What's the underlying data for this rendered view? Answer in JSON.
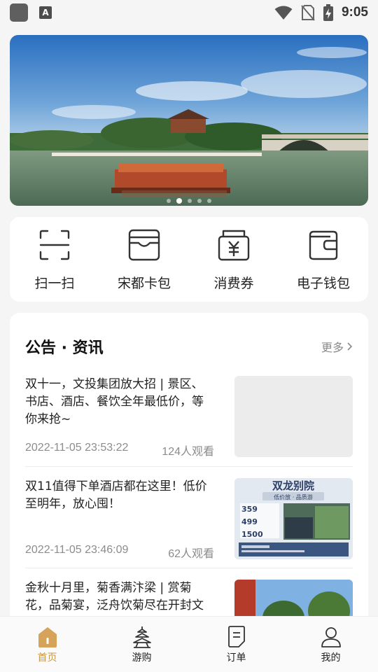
{
  "status_bar": {
    "time": "9:05",
    "notif_letter": "A"
  },
  "banner": {
    "dots_count": 5,
    "active_index": 1
  },
  "quick_actions": [
    {
      "label": "扫一扫",
      "icon": "scan-icon"
    },
    {
      "label": "宋都卡包",
      "icon": "card-wallet-icon"
    },
    {
      "label": "消费券",
      "icon": "coupon-icon"
    },
    {
      "label": "电子钱包",
      "icon": "wallet-icon"
    }
  ],
  "news": {
    "title": "公告 · 资讯",
    "more": "更多",
    "items": [
      {
        "title": "双十一，文投集团放大招 | 景区、书店、酒店、餐饮全年最低价，等你来抢~",
        "date": "2022-11-05 23:53:22",
        "views": "124人观看"
      },
      {
        "title": "双11值得下单酒店都在这里！低价至明年，放心囤！",
        "date": "2022-11-05 23:46:09",
        "views": "62人观看",
        "thumb": {
          "heading": "双龙别院",
          "sub": "低价放 · 品质游",
          "price_1": "359",
          "price_2": "499",
          "price_3": "1500"
        }
      },
      {
        "title": "金秋十月里，菊香满汴梁 | 赏菊花，品菊宴，泛舟饮菊尽在开封文投集团",
        "date": "",
        "views": ""
      }
    ]
  },
  "tabbar": [
    {
      "label": "首页",
      "icon": "home-icon",
      "active": true
    },
    {
      "label": "游购",
      "icon": "tower-icon",
      "active": false
    },
    {
      "label": "订单",
      "icon": "order-icon",
      "active": false
    },
    {
      "label": "我的",
      "icon": "profile-icon",
      "active": false
    }
  ],
  "colors": {
    "accent": "#c9974a",
    "background": "#f5f5f5",
    "card": "#ffffff"
  }
}
